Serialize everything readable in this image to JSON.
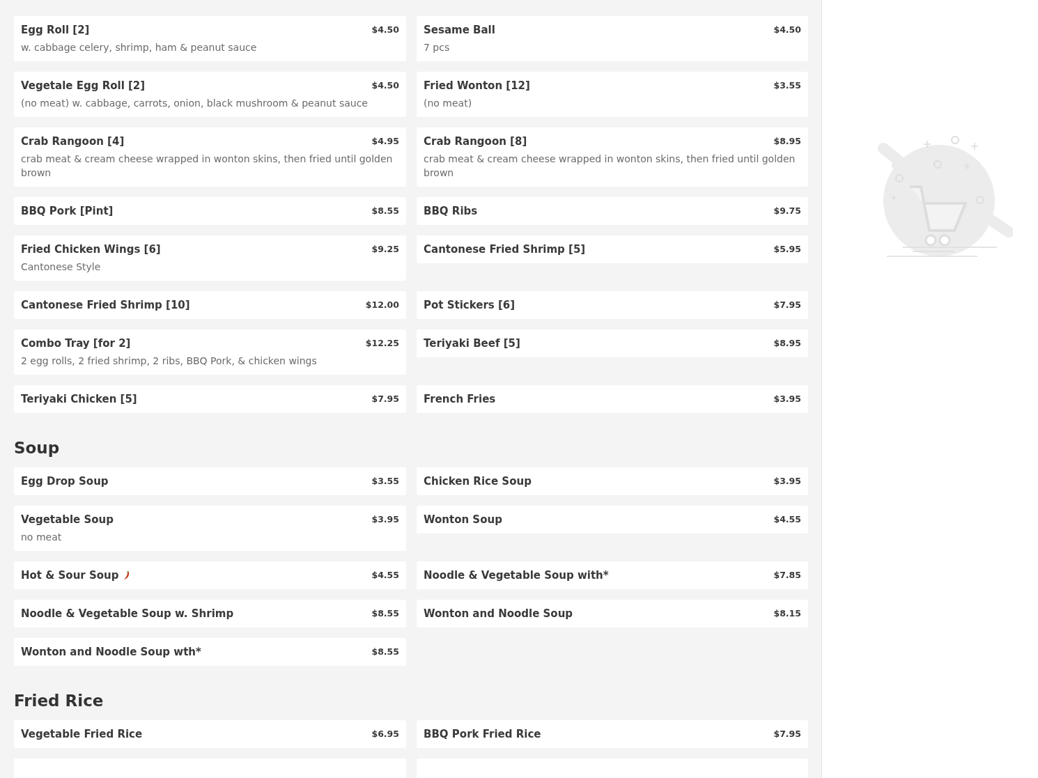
{
  "sections": [
    {
      "items": [
        {
          "name": "Egg Roll [2]",
          "price": "$4.50",
          "description": "w. cabbage celery, shrimp, ham & peanut sauce"
        },
        {
          "name": "Sesame Ball",
          "price": "$4.50",
          "description": "7 pcs"
        },
        {
          "name": "Vegetale Egg Roll [2]",
          "price": "$4.50",
          "description": "(no meat) w. cabbage, carrots, onion, black mushroom & peanut sauce"
        },
        {
          "name": "Fried Wonton [12]",
          "price": "$3.55",
          "description": "(no meat)"
        },
        {
          "name": "Crab Rangoon [4]",
          "price": "$4.95",
          "description": "crab meat & cream cheese wrapped in wonton skins, then fried until golden brown"
        },
        {
          "name": "Crab Rangoon [8]",
          "price": "$8.95",
          "description": "crab meat & cream cheese wrapped in wonton skins, then fried until golden brown"
        },
        {
          "name": "BBQ Pork [Pint]",
          "price": "$8.55"
        },
        {
          "name": "BBQ Ribs",
          "price": "$9.75"
        },
        {
          "name": "Fried Chicken Wings [6]",
          "price": "$9.25",
          "description": "Cantonese Style"
        },
        {
          "name": "Cantonese Fried Shrimp [5]",
          "price": "$5.95"
        },
        {
          "name": "Cantonese Fried Shrimp [10]",
          "price": "$12.00"
        },
        {
          "name": "Pot Stickers [6]",
          "price": "$7.95"
        },
        {
          "name": "Combo Tray [for 2]",
          "price": "$12.25",
          "description": "2 egg rolls, 2 fried shrimp, 2 ribs, BBQ Pork, & chicken wings"
        },
        {
          "name": "Teriyaki Beef [5]",
          "price": "$8.95"
        },
        {
          "name": "Teriyaki Chicken [5]",
          "price": "$7.95"
        },
        {
          "name": "French Fries",
          "price": "$3.95"
        }
      ]
    },
    {
      "title": "Soup",
      "items": [
        {
          "name": "Egg Drop Soup",
          "price": "$3.55"
        },
        {
          "name": "Chicken Rice Soup",
          "price": "$3.95"
        },
        {
          "name": "Vegetable Soup",
          "price": "$3.95",
          "description": "no meat"
        },
        {
          "name": "Wonton Soup",
          "price": "$4.55"
        },
        {
          "name": "Hot & Sour Soup",
          "price": "$4.55",
          "spicy": true
        },
        {
          "name": "Noodle & Vegetable Soup with*",
          "price": "$7.85"
        },
        {
          "name": "Noodle & Vegetable Soup w. Shrimp",
          "price": "$8.55"
        },
        {
          "name": "Wonton and Noodle Soup",
          "price": "$8.15"
        },
        {
          "name": "Wonton and Noodle Soup wth*",
          "price": "$8.55"
        }
      ]
    },
    {
      "title": "Fried Rice",
      "items": [
        {
          "name": "Vegetable Fried Rice",
          "price": "$6.95"
        },
        {
          "name": "BBQ Pork Fried Rice",
          "price": "$7.95"
        }
      ]
    }
  ]
}
